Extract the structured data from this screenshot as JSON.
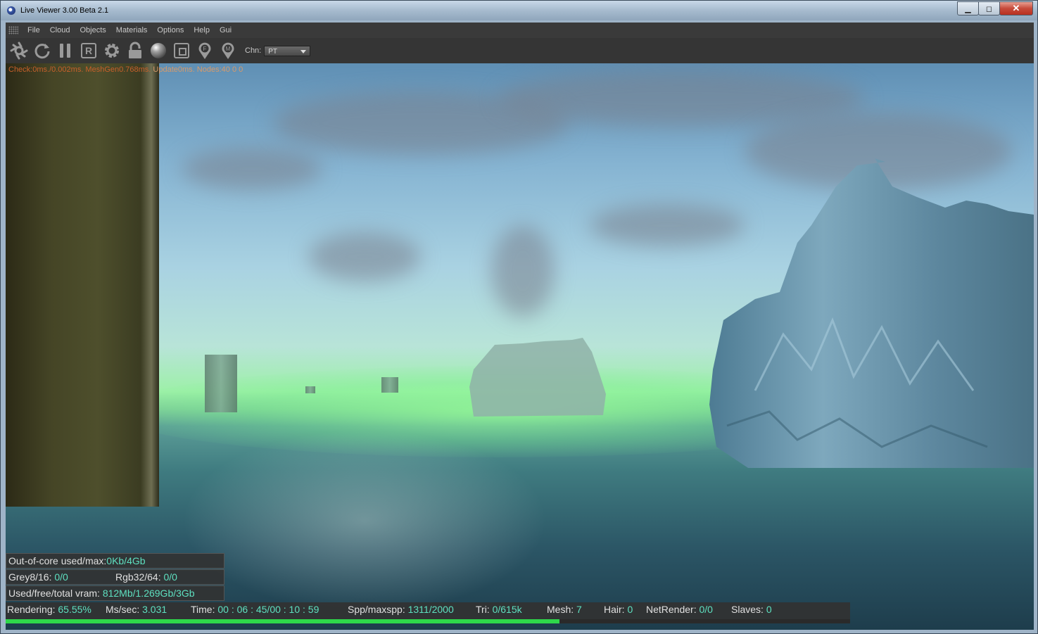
{
  "window": {
    "title": "Live Viewer 3.00 Beta 2.1",
    "min_label": "▁",
    "max_label": "◻",
    "close_label": "✕"
  },
  "menu": [
    "File",
    "Cloud",
    "Objects",
    "Materials",
    "Options",
    "Help",
    "Gui"
  ],
  "toolbar": {
    "icons": [
      "restart-icon",
      "refresh-icon",
      "pause-icon",
      "region-render-icon",
      "settings-icon",
      "lock-icon",
      "material-ball-icon",
      "focus-frame-icon",
      "pick-focus-icon",
      "pick-material-icon"
    ],
    "region_letter": "R",
    "focus_letter": "F",
    "material_letter": "M",
    "channel_label": "Chn:",
    "channel_value": "PT"
  },
  "status_line": {
    "part1": "Check:0ms./0.002ms. MeshGen0.768ms.",
    "part2": " Update0ms. Nodes:40  0 0"
  },
  "info": {
    "ooc_label": "Out-of-core used/max:",
    "ooc_value": "0Kb/4Gb",
    "grey_label": "Grey8/16: ",
    "grey_value": "0/0",
    "rgb_label": "Rgb32/64: ",
    "rgb_value": "0/0",
    "vram_label": "Used/free/total vram: ",
    "vram_value": "812Mb/1.269Gb/3Gb"
  },
  "stats": {
    "rendering_label": "Rendering: ",
    "rendering_value": "65.55%",
    "ms_label": "Ms/sec: ",
    "ms_value": "3.031",
    "time_label": "Time: ",
    "time_value": "00 : 06 : 45/00 : 10 : 59",
    "spp_label": "Spp/maxspp: ",
    "spp_value": "1311/2000",
    "tri_label": "Tri: ",
    "tri_value": "0/615k",
    "mesh_label": "Mesh: ",
    "mesh_value": "7",
    "hair_label": "Hair: ",
    "hair_value": "0",
    "net_label": "NetRender: ",
    "net_value": "0/0",
    "slaves_label": "Slaves: ",
    "slaves_value": "0"
  },
  "progress": 0.6555,
  "colors": {
    "accent_value": "#5ee0c0",
    "progress": "#2ed84a",
    "status_text": "#c8602a"
  }
}
